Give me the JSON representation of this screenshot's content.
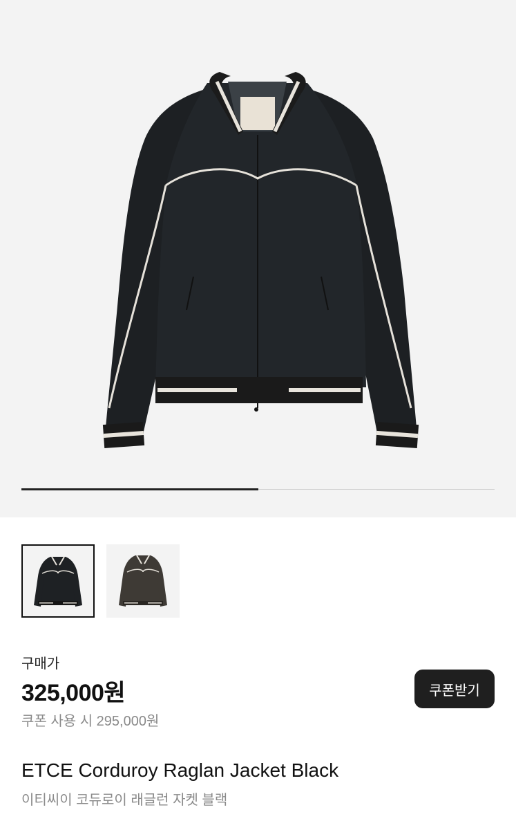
{
  "gallery": {
    "main_image_alt": "ETCE Corduroy Raglan Jacket Black",
    "progress": 0.5,
    "thumbnails": [
      {
        "color_name": "Black",
        "body_color": "#1e2124",
        "selected": true
      },
      {
        "color_name": "Brown",
        "body_color": "#3e3a35",
        "selected": false
      }
    ]
  },
  "pricing": {
    "label": "구매가",
    "price": "325,000원",
    "coupon_price": "쿠폰 사용 시 295,000원",
    "coupon_button": "쿠폰받기"
  },
  "product": {
    "name_en": "ETCE Corduroy Raglan Jacket Black",
    "name_ko": "이티씨이 코듀로이 래글런 자켓 블랙"
  },
  "colors": {
    "accent": "#1f1f1f",
    "muted_text": "#8a8a8a",
    "hero_bg": "#f3f3f3"
  }
}
